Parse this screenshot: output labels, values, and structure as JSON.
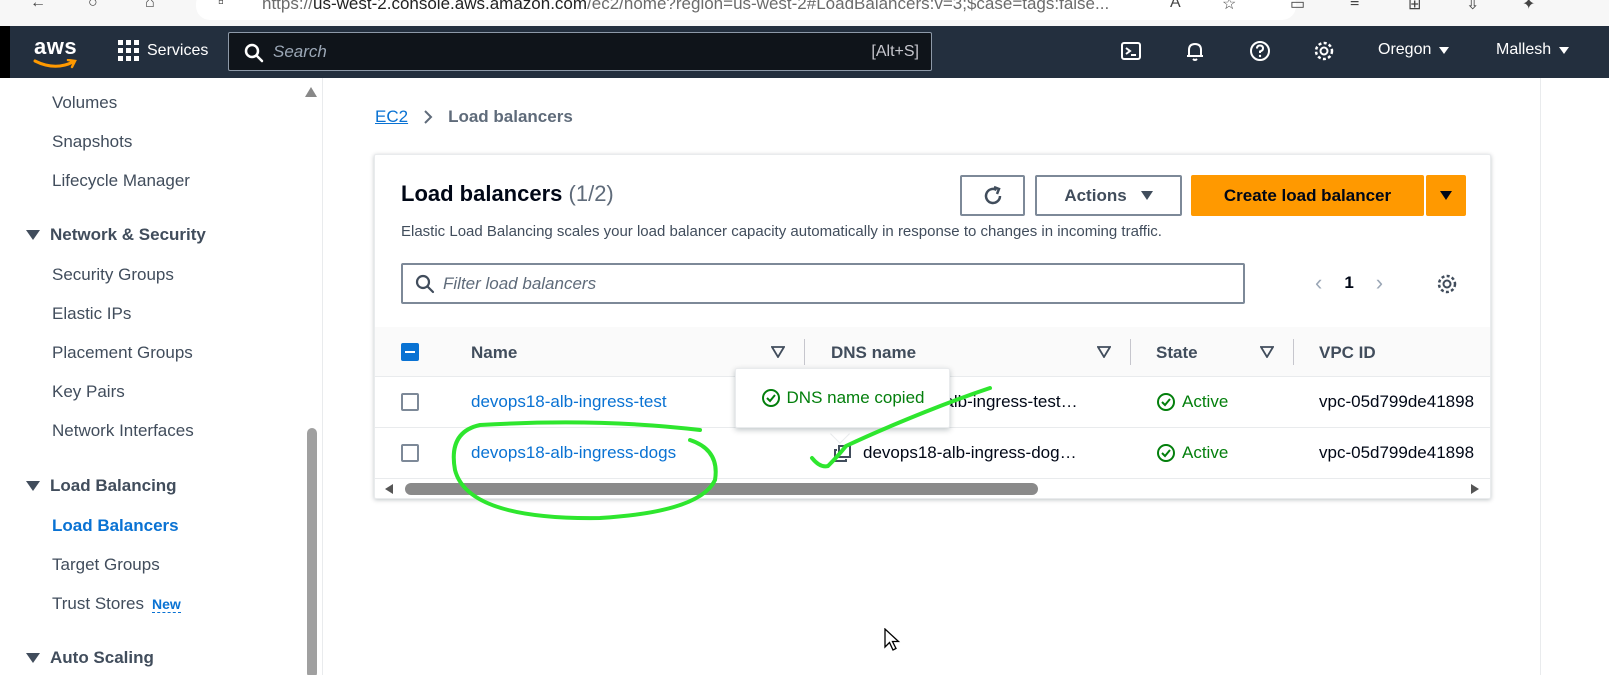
{
  "browser": {
    "url_prefix": "https://",
    "url_domain": "us-west-2.console.aws.amazon.com",
    "url_path": "/ec2/home?region=us-west-2#LoadBalancers:v=3;$case=tags:false..."
  },
  "topnav": {
    "logo": "aws",
    "services_label": "Services",
    "search_placeholder": "Search",
    "search_shortcut": "[Alt+S]",
    "region_label": "Oregon",
    "user_label": "Mallesh"
  },
  "sidebar": {
    "items_top": [
      "Volumes",
      "Snapshots",
      "Lifecycle Manager"
    ],
    "section_network": "Network & Security",
    "items_network": [
      "Security Groups",
      "Elastic IPs",
      "Placement Groups",
      "Key Pairs",
      "Network Interfaces"
    ],
    "section_lb": "Load Balancing",
    "items_lb": [
      "Load Balancers",
      "Target Groups",
      "Trust Stores"
    ],
    "new_badge": "New",
    "section_autoscaling": "Auto Scaling"
  },
  "breadcrumb": {
    "root": "EC2",
    "current": "Load balancers"
  },
  "panel": {
    "title": "Load balancers",
    "count": "(1/2)",
    "description": "Elastic Load Balancing scales your load balancer capacity automatically in response to changes in incoming traffic.",
    "actions_label": "Actions",
    "create_label": "Create load balancer",
    "filter_placeholder": "Filter load balancers",
    "page_number": "1"
  },
  "table": {
    "columns": [
      "Name",
      "DNS name",
      "State",
      "VPC ID"
    ],
    "rows": [
      {
        "name": "devops18-alb-ingress-test",
        "dns": "devops18-alb-ingress-test…",
        "state": "Active",
        "vpc": "vpc-05d799de41898"
      },
      {
        "name": "devops18-alb-ingress-dogs",
        "dns": "devops18-alb-ingress-dog…",
        "state": "Active",
        "vpc": "vpc-05d799de41898"
      }
    ]
  },
  "tooltip": {
    "text": "DNS name copied"
  },
  "colors": {
    "nav_bg": "#232f3e",
    "link": "#0972d3",
    "primary": "#ff9900",
    "success": "#037f0c",
    "annotation": "#2ee62e"
  }
}
